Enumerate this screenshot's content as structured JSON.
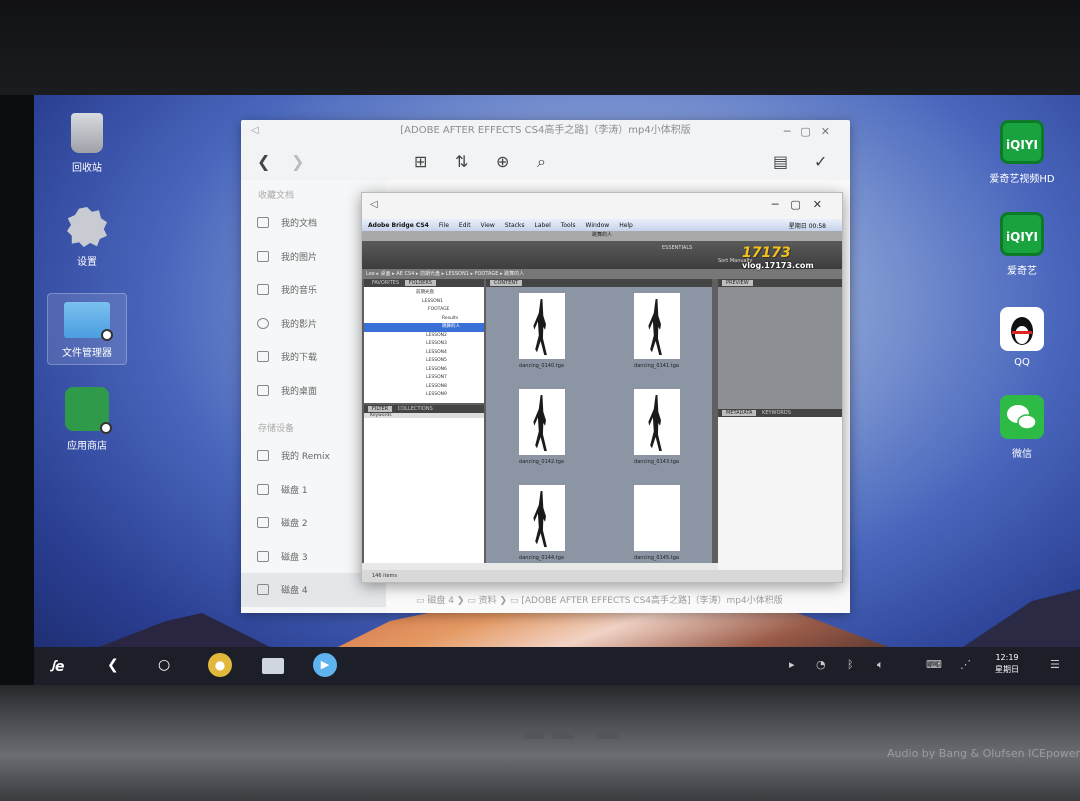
{
  "desktop": {
    "icons_left": [
      {
        "label": "回收站",
        "icon": "trash-icon"
      },
      {
        "label": "设置",
        "icon": "gear-icon"
      },
      {
        "label": "文件管理器",
        "icon": "folder-icon"
      },
      {
        "label": "应用商店",
        "icon": "app-store-icon"
      }
    ],
    "icons_right": [
      {
        "label": "爱奇艺视频HD",
        "icon": "iqiyi-hd-icon",
        "glyph": "iQIYI"
      },
      {
        "label": "爱奇艺",
        "icon": "iqiyi-icon",
        "glyph": "iQIYI"
      },
      {
        "label": "QQ",
        "icon": "qq-icon"
      },
      {
        "label": "微信",
        "icon": "wechat-icon"
      }
    ]
  },
  "file_manager": {
    "title": "[ADOBE AFTER EFFECTS CS4高手之路]（李涛）mp4小体积版",
    "sidebar": {
      "section1": "收藏文档",
      "items1": [
        "我的文档",
        "我的图片",
        "我的音乐",
        "我的影片",
        "我的下载",
        "我的桌面"
      ],
      "section2": "存储设备",
      "items2": [
        "我的 Remix",
        "磁盘 1",
        "磁盘 2",
        "磁盘 3",
        "磁盘 4"
      ]
    },
    "breadcrumb": [
      "磁盘 4",
      "资料",
      "[ADOBE AFTER EFFECTS CS4高手之路]（李涛）mp4小体积版"
    ]
  },
  "bridge": {
    "menu": [
      "Adobe Bridge CS4",
      "File",
      "Edit",
      "View",
      "Stacks",
      "Label",
      "Tools",
      "Window",
      "Help"
    ],
    "clock": "星期日 00:58",
    "window_title": "跳舞的人",
    "workspace": "ESSENTIALS",
    "sort": "Sort Manually",
    "path": [
      "Lee",
      "桌面",
      "AE CS4",
      "前期光盘",
      "LESSON1",
      "FOOTAGE",
      "跳舞的人"
    ],
    "tabs_left": [
      "FAVORITES",
      "FOLDERS"
    ],
    "tab_content": "CONTENT",
    "tab_preview": "PREVIEW",
    "tabs_filter": [
      "FILTER",
      "COLLECTIONS"
    ],
    "filter_item": "Keywords",
    "tabs_meta": [
      "METADATA",
      "KEYWORDS"
    ],
    "tree": [
      "前期光盘",
      "LESSON1",
      "FOOTAGE",
      "Results",
      "跳舞的人",
      "LESSON2",
      "LESSON3",
      "LESSON4",
      "LESSON5",
      "LESSON6",
      "LESSON7",
      "LESSON8",
      "LESSON9"
    ],
    "thumbs": [
      "dancing_0140.tga",
      "dancing_0141.tga",
      "dancing_0142.tga",
      "dancing_0143.tga",
      "dancing_0144.tga",
      "dancing_0145.tga"
    ],
    "status": "146 items",
    "watermark": "17173",
    "watermark_url": "vlog.17173.com"
  },
  "taskbar": {
    "logo": "ꭍe",
    "time": "12:19",
    "day": "星期日"
  },
  "laptop": {
    "audio": "Audio by Bang & Olufsen ICEpower"
  }
}
